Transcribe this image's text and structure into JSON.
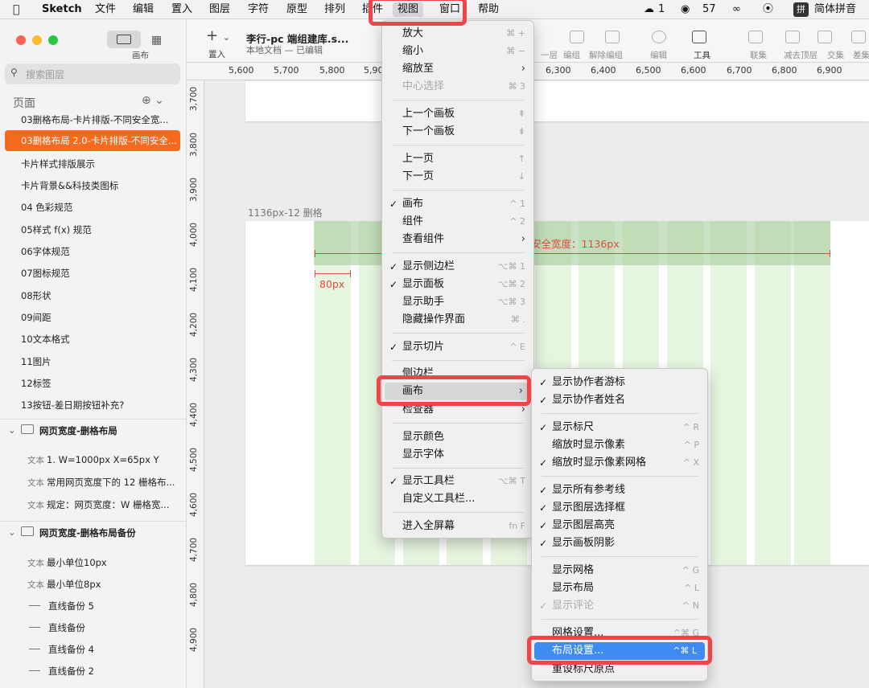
{
  "menubar": {
    "app": "Sketch",
    "items": [
      "文件",
      "编辑",
      "置入",
      "图层",
      "字符",
      "原型",
      "排列",
      "插件",
      "视图",
      "窗口",
      "帮助"
    ],
    "status": {
      "badge1": "1",
      "wechat": "57",
      "ime_icon": "拼",
      "ime": "简体拼音"
    }
  },
  "left_panel": {
    "view_label": "画布",
    "search_placeholder": "搜索图层",
    "pages_header": "页面",
    "pages": [
      "03删格布局-卡片排版-不同安全宽...",
      "03删格布局 2.0-卡片排版-不同安全...",
      "卡片样式排版展示",
      "卡片背景&&科技类图标",
      "04 色彩规范",
      "05样式 f(x) 规范",
      "06字体规范",
      "07图标规范",
      "08形状",
      "09间距",
      "10文本格式",
      "11图片",
      "12标签",
      "13按钮-差日期按钮补充?"
    ],
    "selected_page_index": 1,
    "groups": [
      {
        "name": "网页宽度-删格布局",
        "layers": [
          {
            "kind": "文本",
            "name": "1. W=1000px X=65px Y"
          },
          {
            "kind": "文本",
            "name": "常用网页宽度下的 12 栅格布..."
          },
          {
            "kind": "文本",
            "name": "规定：网页宽度：W 栅格宽..."
          }
        ]
      },
      {
        "name": "网页宽度-删格布局备份",
        "layers": [
          {
            "kind": "文本",
            "name": "最小单位10px"
          },
          {
            "kind": "文本",
            "name": "最小单位8px"
          },
          {
            "kind": "line",
            "name": "直线备份 5"
          },
          {
            "kind": "line",
            "name": "直线备份"
          },
          {
            "kind": "line",
            "name": "直线备份 4"
          },
          {
            "kind": "line",
            "name": "直线备份 2"
          }
        ]
      }
    ]
  },
  "toolbar": {
    "insert_label": "置入",
    "doc_title": "李行-pc 端组建库.s...",
    "doc_sub": "本地文档 — 已编辑",
    "tools": [
      "一层",
      "编组",
      "解除编组",
      "编辑",
      "工具",
      "联集",
      "减去顶层",
      "交集",
      "差集"
    ]
  },
  "rulers": {
    "h": [
      "5,600",
      "5,700",
      "5,800",
      "5,90",
      "6,300",
      "6,400",
      "6,500",
      "6,600",
      "6,700",
      "6,800",
      "6,900"
    ],
    "v": [
      "3,700",
      "3,800",
      "3,900",
      "4,000",
      "4,100",
      "4,200",
      "4,300",
      "4,400",
      "4,500",
      "4,600",
      "4,700",
      "4,800",
      "4,900"
    ]
  },
  "canvas": {
    "artboard_name": "1136px-12 删格",
    "safe_width_label": "安全宽度：1136px",
    "gutter_label": "80px"
  },
  "view_menu": {
    "items": [
      {
        "label": "放大",
        "shortcut": "⌘ +"
      },
      {
        "label": "缩小",
        "shortcut": "⌘ −"
      },
      {
        "label": "缩放至",
        "arrow": "›"
      },
      {
        "label": "中心选择",
        "shortcut": "⌘ 3",
        "disabled": true
      },
      {
        "label": "上一个画板",
        "shortcut": "⇞"
      },
      {
        "label": "下一个画板",
        "shortcut": "⇟"
      },
      {
        "label": "上一页",
        "shortcut": "↑"
      },
      {
        "label": "下一页",
        "shortcut": "↓"
      },
      {
        "label": "画布",
        "shortcut": "^ 1",
        "checked": true
      },
      {
        "label": "组件",
        "shortcut": "^ 2"
      },
      {
        "label": "查看组件",
        "arrow": "›"
      },
      {
        "label": "显示侧边栏",
        "shortcut": "⌥⌘ 1",
        "checked": true
      },
      {
        "label": "显示面板",
        "shortcut": "⌥⌘ 2",
        "checked": true
      },
      {
        "label": "显示助手",
        "shortcut": "⌥⌘ 3"
      },
      {
        "label": "隐藏操作界面",
        "shortcut": "⌘ ."
      },
      {
        "label": "显示切片",
        "shortcut": "^ E",
        "checked": true
      },
      {
        "label": "侧边栏",
        "arrow": "›"
      },
      {
        "label": "画布",
        "arrow": "›"
      },
      {
        "label": "检查器",
        "arrow": "›"
      },
      {
        "label": "显示颜色"
      },
      {
        "label": "显示字体"
      },
      {
        "label": "显示工具栏",
        "shortcut": "⌥⌘ T",
        "checked": true
      },
      {
        "label": "自定义工具栏..."
      },
      {
        "label": "进入全屏幕",
        "shortcut": "fn F"
      }
    ]
  },
  "canvas_submenu": {
    "items": [
      {
        "label": "显示协作者游标",
        "checked": true
      },
      {
        "label": "显示协作者姓名",
        "checked": true
      },
      {
        "label": "显示标尺",
        "shortcut": "^ R",
        "checked": true
      },
      {
        "label": "缩放时显示像素",
        "shortcut": "^ P"
      },
      {
        "label": "缩放时显示像素网格",
        "shortcut": "^ X",
        "checked": true
      },
      {
        "label": "显示所有参考线",
        "checked": true
      },
      {
        "label": "显示图层选择框",
        "checked": true
      },
      {
        "label": "显示图层高亮",
        "checked": true
      },
      {
        "label": "显示画板阴影",
        "checked": true
      },
      {
        "label": "显示网格",
        "shortcut": "^ G"
      },
      {
        "label": "显示布局",
        "shortcut": "^ L"
      },
      {
        "label": "显示评论",
        "shortcut": "^ N",
        "checked": true,
        "disabled": true
      },
      {
        "label": "网格设置...",
        "shortcut": "^⌘ G"
      },
      {
        "label": "布局设置...",
        "shortcut": "^⌘ L"
      },
      {
        "label": "重设标尺原点"
      }
    ]
  },
  "colors": {
    "accent_orange": "#f56a1e",
    "highlight_blue": "#3e8bf1",
    "annotation_red": "#f0444a",
    "measure_red": "#e24a3b",
    "grid_green": "#e6f5e0"
  }
}
